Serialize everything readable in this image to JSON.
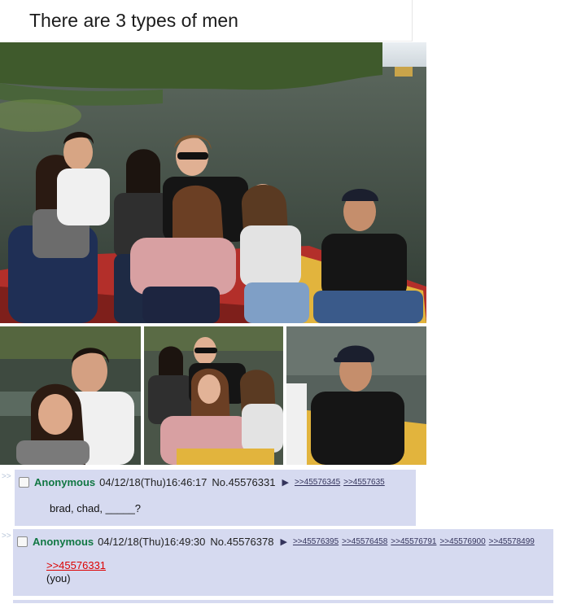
{
  "caption": {
    "title": "There are 3 types of men"
  },
  "side_arrow": ">>",
  "posts": [
    {
      "name": "Anonymous",
      "datetime": "04/12/18(Thu)16:46:17",
      "number": "No.45576331",
      "arrow": "▶",
      "replies": [
        ">>45576345",
        ">>4557635"
      ],
      "message": "brad, chad, _____?"
    },
    {
      "name": "Anonymous",
      "datetime": "04/12/18(Thu)16:49:30",
      "number": "No.45576378",
      "arrow": "▶",
      "replies": [
        ">>45576395",
        ">>45576458",
        ">>45576791",
        ">>45576900",
        ">>45578499"
      ],
      "quote": ">>45576331",
      "message": "(you)"
    }
  ],
  "colors": {
    "post_bg": "#d6daf0",
    "name_green": "#117743",
    "link_blue": "#34345c",
    "quote_red": "#dd0000"
  }
}
